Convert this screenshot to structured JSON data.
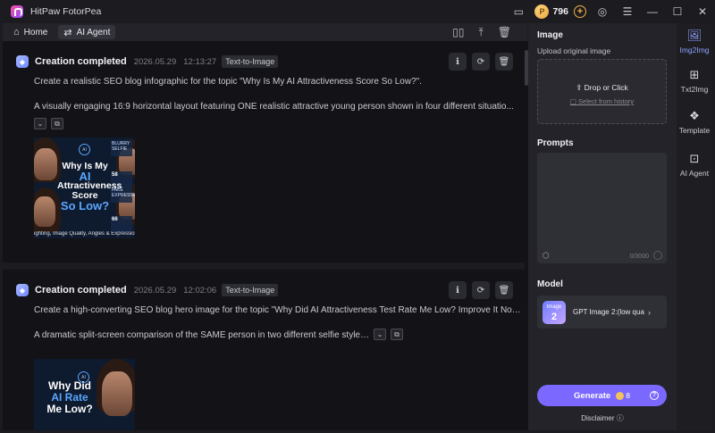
{
  "app": {
    "title": "HitPaw FotorPea"
  },
  "titlebar": {
    "coin_symbol": "P",
    "coins": "796",
    "plus": "+"
  },
  "toolbar": {
    "home_label": "Home",
    "agent_label": "AI Agent"
  },
  "feed": [
    {
      "title": "Creation completed",
      "date": "2026.05.29",
      "time": "12:13:27",
      "tag": "Text-to-Image",
      "prompt_1": "Create a realistic SEO blog infographic for the topic \"Why Is My AI Attractiveness Score So Low?\".",
      "prompt_2": "A visually engaging 16:9 horizontal layout featuring ONE realistic attractive young person shown in four different situatio...",
      "image": {
        "headline_1": "Why Is My",
        "headline_2": "AI",
        "headline_3": "Attractiveness",
        "headline_4": "Score",
        "headline_5": "So Low?",
        "badge": "AI",
        "side_1_label": "BLURRY SELFIE",
        "side_1_value": "58",
        "side_2_label": "FAKE EXPRESSION",
        "side_2_value": "66",
        "footer": "ighting, Image Quality, Angles & Expression Ma"
      }
    },
    {
      "title": "Creation completed",
      "date": "2026.05.29",
      "time": "12:02:06",
      "tag": "Text-to-Image",
      "prompt_1": "Create a high-converting SEO blog hero image for the topic \"Why Did AI Attractiveness Test Rate Me Low? Improve It Now\".",
      "prompt_2": "A dramatic split-screen comparison of the SAME person in two different selfie styles....",
      "image": {
        "badge": "AI",
        "headline_1": "Why Did",
        "headline_2": "AI Rate",
        "headline_3": "Me Low?"
      }
    }
  ],
  "sidepanel": {
    "image_label": "Image",
    "upload_sub": "Upload original image",
    "upload_main": "Drop or Click",
    "upload_link": "Select from history",
    "prompts_label": "Prompts",
    "prompt_count": "0/3000",
    "model_label": "Model",
    "model_name": "GPT Image 2:(low qual...",
    "model_icon_text": "Image",
    "model_icon_num": "2",
    "generate_label": "Generate",
    "generate_cost": "8",
    "disclaimer": "Disclaimer"
  },
  "rail": [
    {
      "label": "Img2Img",
      "icon": "image-icon",
      "active": true
    },
    {
      "label": "Txt2Img",
      "icon": "text-image-icon",
      "active": false
    },
    {
      "label": "Template",
      "icon": "template-icon",
      "active": false
    },
    {
      "label": "AI Agent",
      "icon": "agent-icon",
      "active": false
    }
  ],
  "colors": {
    "accent": "#7b68ff",
    "rail_active": "#8ea2ff",
    "coin": "#f5b142",
    "feed_bg": "#131317",
    "panel_bg": "#232329"
  }
}
